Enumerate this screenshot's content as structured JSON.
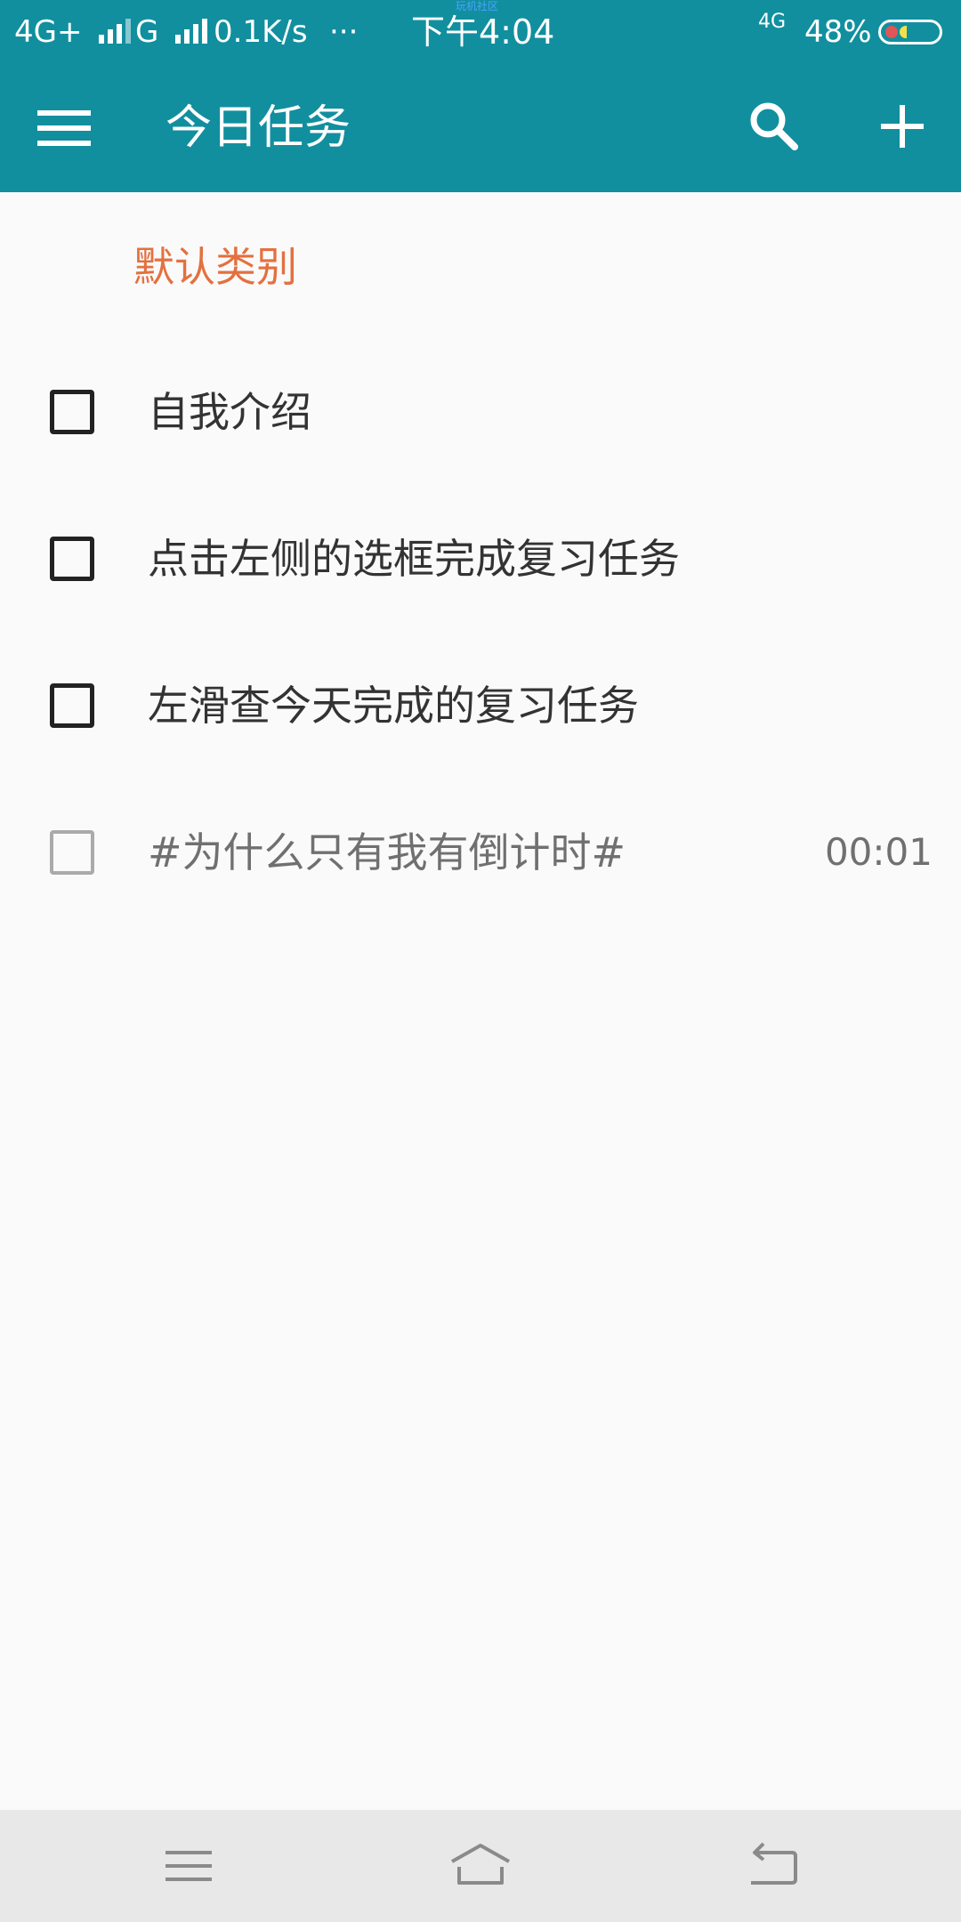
{
  "status_bar": {
    "network_left": "4G+",
    "network_second": "G",
    "speed": "0.1K/s",
    "more": "···",
    "time": "下午4:04",
    "network_right": "4G",
    "battery": "48%",
    "watermark": "玩机社区",
    "color": "#118f9f"
  },
  "toolbar": {
    "title": "今日任务",
    "menu_icon": "hamburger-menu-icon",
    "search_icon": "search-icon",
    "add_icon": "plus-icon"
  },
  "category": {
    "label": "默认类别",
    "color": "#e4703f"
  },
  "tasks": [
    {
      "text": "自我介绍",
      "timer": "",
      "checked": false
    },
    {
      "text": "点击左侧的选框完成复习任务",
      "timer": "",
      "checked": false
    },
    {
      "text": "左滑查今天完成的复习任务",
      "timer": "",
      "checked": false
    },
    {
      "text": "#为什么只有我有倒计时#",
      "timer": "00:01",
      "checked": false
    }
  ],
  "nav_bar": {
    "menu_icon": "recent-apps-icon",
    "home_icon": "home-icon",
    "back_icon": "back-icon"
  }
}
